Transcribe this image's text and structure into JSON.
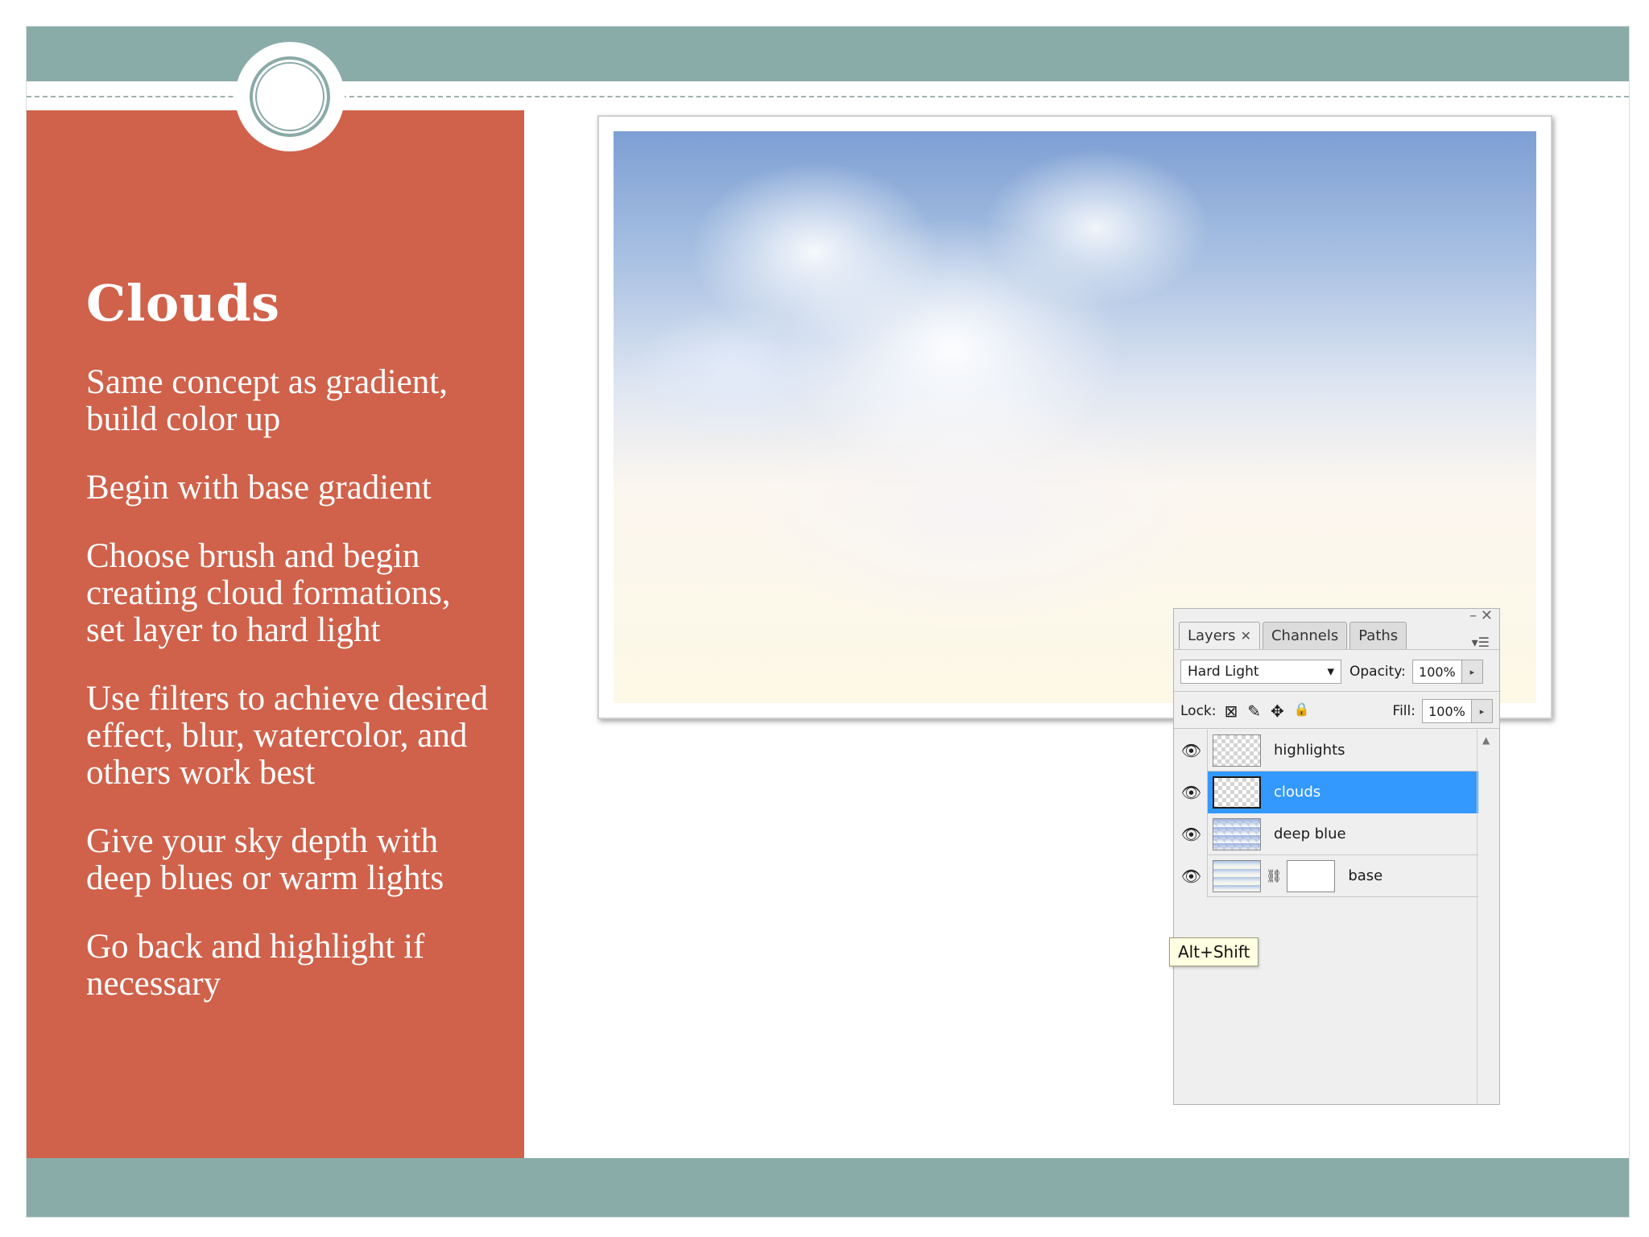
{
  "theme": {
    "bar_color": "#8aaca9",
    "panel_color": "#d0614a",
    "text_on_panel": "#ffffff",
    "selection_color": "#3399ff"
  },
  "slide": {
    "title": "Clouds",
    "bullets": [
      "Same concept as gradient, build color up",
      "Begin with base gradient",
      "Choose brush and begin creating cloud formations, set layer to hard light",
      "Use filters to achieve desired effect, blur, watercolor, and others work best",
      "Give your sky depth with deep blues or warm lights",
      "Go back and highlight if necessary"
    ]
  },
  "layers_panel": {
    "window_minimize": "–",
    "window_close": "✕",
    "tabs": [
      {
        "label": "Layers",
        "close": "✕",
        "active": true
      },
      {
        "label": "Channels",
        "active": false
      },
      {
        "label": "Paths",
        "active": false
      }
    ],
    "menu_icon": "▾☰",
    "blend_mode": "Hard Light",
    "blend_arrow": "▾",
    "opacity_label": "Opacity:",
    "opacity_value": "100%",
    "lock_label": "Lock:",
    "fill_label": "Fill:",
    "fill_value": "100%",
    "arrow": "▸",
    "lock_icons": {
      "transparency": "⊠",
      "paint": "✎",
      "move": "✥",
      "all": "🔒"
    },
    "eye_icon": "👁",
    "link_icon": "⛓",
    "layers": [
      {
        "name": "highlights",
        "selected": false
      },
      {
        "name": "clouds",
        "selected": true
      },
      {
        "name": "deep blue",
        "selected": false
      },
      {
        "name": "base",
        "selected": false
      }
    ],
    "scroll_up": "▲"
  },
  "tooltip": {
    "text": "Alt+Shift"
  }
}
